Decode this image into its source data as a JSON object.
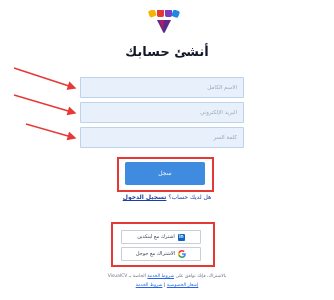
{
  "header": {
    "title": "أنشئ حسابك"
  },
  "form": {
    "name_placeholder": "الاسم الكامل",
    "email_placeholder": "البريد الإلكتروني",
    "password_placeholder": "كلمة السر",
    "submit_label": "سجل"
  },
  "signin": {
    "prompt": "هل لديك حساب؟",
    "link_label": "تسجيل الدخول"
  },
  "social": {
    "linkedin_label": "اشترك مع لينكدين",
    "google_label": "الاشتراك مع جوجل"
  },
  "footer": {
    "terms_prefix": "بالاشتراك، فإنك توافق على",
    "terms_link": "شروط الخدمة",
    "brand_text": "VisualCV",
    "terms_suffix": "الخاصة بـ",
    "privacy_link": "إشعار الخصوصية",
    "separator": " | ",
    "service_link": "شروط الخدمة"
  },
  "colors": {
    "accent": "#3e8be0",
    "highlight": "#e53935",
    "field_bg": "#e8f0fb",
    "link": "#1a3ea8"
  },
  "icons": {
    "logo": "multicolor-fan-logo",
    "linkedin": "linkedin-icon",
    "google": "google-icon"
  }
}
